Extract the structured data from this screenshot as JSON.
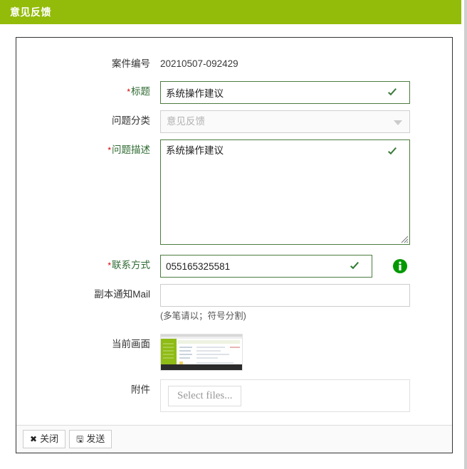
{
  "window": {
    "title": "意见反馈"
  },
  "form": {
    "case_no": {
      "label": "案件编号",
      "value": "20210507-092429"
    },
    "title_field": {
      "label": "标题",
      "required": true,
      "value": "系统操作建议",
      "valid_icon": "check-icon"
    },
    "category": {
      "label": "问题分类",
      "value": "意见反馈",
      "disabled": true,
      "arrow_icon": "chevron-down-icon"
    },
    "description": {
      "label": "问题描述",
      "required": true,
      "value": "系统操作建议",
      "valid_icon": "check-icon",
      "resize_icon": "resize-grip-icon"
    },
    "contact": {
      "label": "联系方式",
      "required": true,
      "value": "055165325581",
      "valid_icon": "check-icon",
      "info_icon": "info-circle-icon"
    },
    "cc_mail": {
      "label": "副本通知Mail",
      "value": "",
      "placeholder": "",
      "hint": "(多笔请以；符号分割)"
    },
    "current_screen": {
      "label": "当前画面",
      "thumbnail_alt": "screenshot-thumbnail"
    },
    "attachment": {
      "label": "附件",
      "select_files_label": "Select files..."
    },
    "required_marker": "*"
  },
  "footer": {
    "close_button": {
      "label": "关闭",
      "icon": "close-x-icon",
      "glyph": "✖"
    },
    "send_button": {
      "label": "发送",
      "icon": "save-disk-icon",
      "glyph": "🖫"
    }
  },
  "colors": {
    "header_green": "#93bb09",
    "accent_green": "#4c7c3f",
    "label_green": "#2f6b33",
    "required_red": "#d40000",
    "info_green": "#009900"
  }
}
